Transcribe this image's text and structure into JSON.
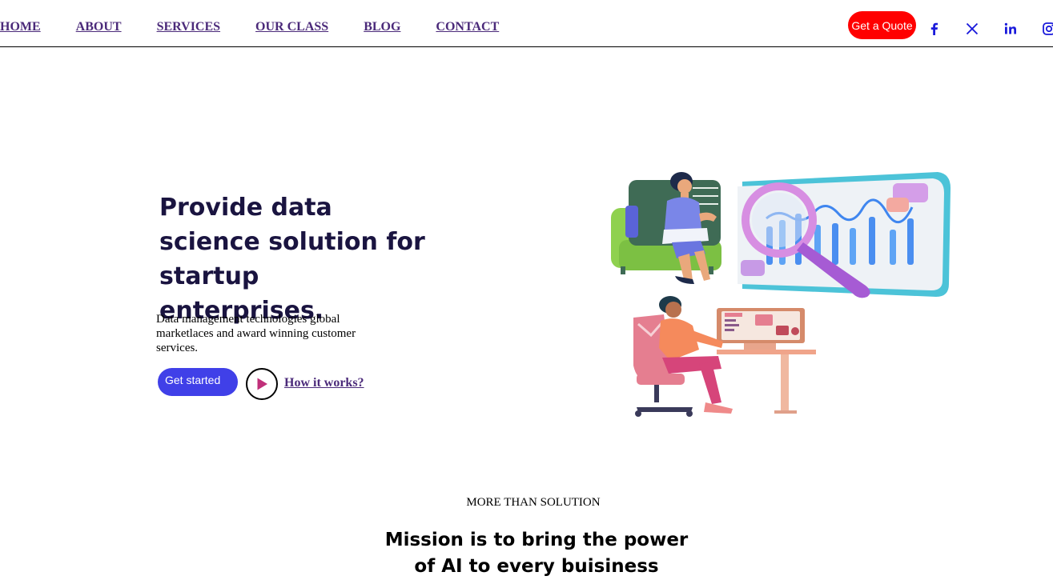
{
  "nav": {
    "links": [
      "HOME",
      "ABOUT",
      "SERVICES",
      "OUR CLASS",
      "BLOG",
      "CONTACT"
    ],
    "quote_label": "Get a Quote",
    "social_icons": [
      "facebook-icon",
      "x-icon",
      "linkedin-icon",
      "instagram-icon"
    ]
  },
  "hero": {
    "title": "Provide data science solution for startup enterprises.",
    "description": "Data management technologies global marketlaces and award winning customer services.",
    "cta_label": "Get started",
    "how_label": "How it works?",
    "play_icon": "play-icon"
  },
  "section": {
    "eyebrow": "MORE THAN SOLUTION",
    "title_line1": "Mission is to bring the power",
    "title_line2": "of AI to every buisiness"
  },
  "colors": {
    "brand_dark": "#1a1440",
    "link_purple": "#4b2a7a",
    "quote_red": "#ff0000",
    "primary_blue": "#4040e8",
    "social_blue": "#1a1adb",
    "play_pink": "#c0307a"
  }
}
